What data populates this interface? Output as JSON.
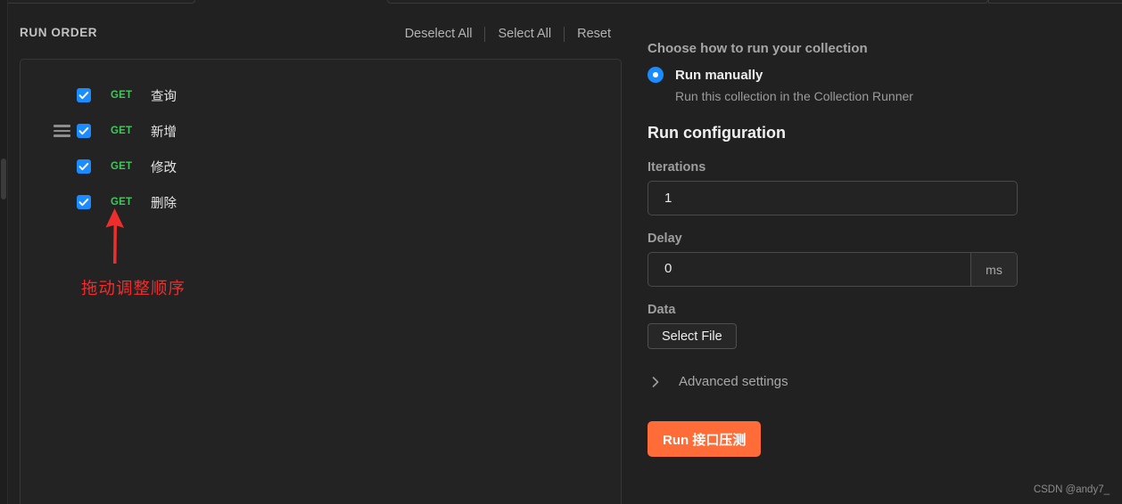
{
  "left_panel": {
    "title": "RUN ORDER",
    "actions": [
      {
        "label": "Deselect All"
      },
      {
        "label": "Select All"
      },
      {
        "label": "Reset"
      }
    ],
    "requests": [
      {
        "method": "GET",
        "name": "查询",
        "checked": true,
        "has_drag_handle": false
      },
      {
        "method": "GET",
        "name": "新增",
        "checked": true,
        "has_drag_handle": true
      },
      {
        "method": "GET",
        "name": "修改",
        "checked": true,
        "has_drag_handle": false
      },
      {
        "method": "GET",
        "name": "删除",
        "checked": true,
        "has_drag_handle": false
      }
    ]
  },
  "annotation": {
    "text": "拖动调整顺序",
    "color": "#ee2d2d",
    "arrow": "up-arrow-icon"
  },
  "right_panel": {
    "choose_title": "Choose how to run your collection",
    "run_mode": {
      "label": "Run manually",
      "description": "Run this collection in the Collection Runner",
      "selected": true
    },
    "run_configuration_title": "Run configuration",
    "iterations": {
      "label": "Iterations",
      "value": "1"
    },
    "delay": {
      "label": "Delay",
      "value": "0",
      "unit": "ms"
    },
    "data": {
      "label": "Data",
      "button_label": "Select File"
    },
    "advanced_settings": {
      "label": "Advanced settings",
      "expanded": false
    },
    "run_button": {
      "label": "Run 接口压测"
    }
  },
  "watermark": "CSDN @andy7_",
  "colors": {
    "accent_blue": "#1a8cff",
    "method_get_green": "#3ec95a",
    "run_orange": "#ff6c37",
    "annotation_red": "#ee2d2d",
    "background": "#212121"
  }
}
